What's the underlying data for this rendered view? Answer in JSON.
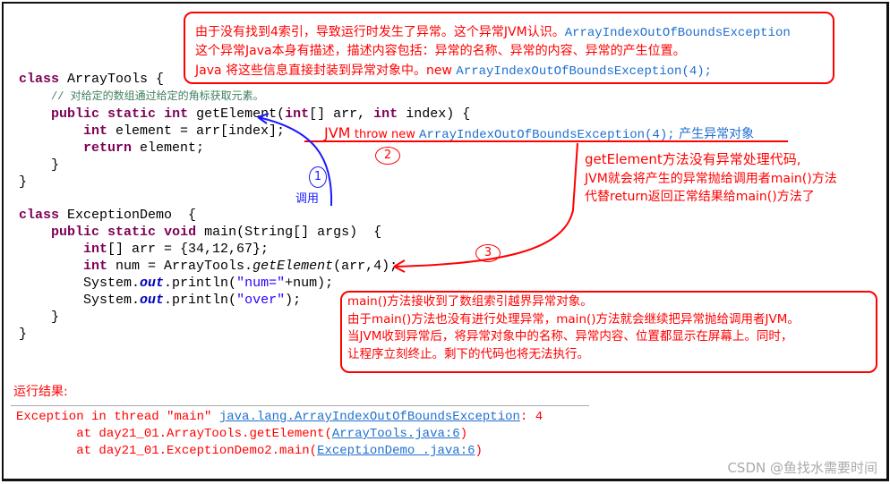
{
  "colors": {
    "annotation": "#ff0000",
    "accent_blue": "#1e6fd0",
    "keyword": "#7f0055",
    "comment": "#3f7f5f"
  },
  "top_box": {
    "line1_cn": "由于没有找到4索引，导致运行时发生了异常。这个异常JVM认识。",
    "line1_code": "ArrayIndexOutOfBoundsException",
    "line2": "这个异常Java本身有描述，描述内容包括：异常的名称、异常的内容、异常的产生位置。",
    "line3_cn": "Java 将这些信息直接封装到异常对象中。new ",
    "line3_code": "ArrayIndexOutOfBoundsException(4);"
  },
  "code": {
    "class1": "ArrayTools {",
    "comment": "// 对给定的数组通过给定的角标获取元素。",
    "method1": "getElement(",
    "method1_params": "[] arr, ",
    "method1_params2": " index) {",
    "line_element": " element = arr[index];",
    "line_return": " element;",
    "class2": "ExceptionDemo  {",
    "main_sig": " main(String[] args)  {",
    "arr_decl": "[] arr = {34,12,67};",
    "num_decl1": " num = ArrayTools.",
    "num_decl_method": "getElement",
    "num_decl2": "(arr,4);",
    "println1a": "System.",
    "println_out": "out",
    "println1b": ".println(",
    "println1_str": "\"num=\"",
    "println1c": "+num);",
    "println2_str": "\"over\"",
    "println2c": ");"
  },
  "throw_note": {
    "jvm": "JVM",
    "throw": "throw new ",
    "code": "ArrayIndexOutOfBoundsException(4);",
    "cn": " 产生异常对象"
  },
  "steps": {
    "one": "1",
    "two": "2",
    "three": "3",
    "call_label": "调用"
  },
  "side_note": {
    "line1": "getElement方法没有异常处理代码,",
    "line2": "JVM就会将产生的异常抛给调用者main()方法",
    "line3": "代替return返回正常结果给main()方法了"
  },
  "bottom_box": {
    "line1": "main()方法接收到了数组索引越界异常对象。",
    "line2": "由于main()方法也没有进行处理异常，main()方法就会继续把异常抛给调用者JVM。",
    "line3": "当JVM收到异常后，将异常对象中的名称、异常内容、位置都显示在屏幕上。同时，",
    "line4": "让程序立刻终止。剩下的代码也将无法执行。"
  },
  "result": {
    "label": "运行结果:",
    "line1_pre": "Exception in thread \"main\" ",
    "line1_link": "java.lang.ArrayIndexOutOfBoundsException",
    "line1_post": ": 4",
    "line2_pre": "        at day21_01.ArrayTools.getElement(",
    "line2_link": "ArrayTools.java:6",
    "line3_pre": "        at day21_01.ExceptionDemo2.main(",
    "line3_link": "ExceptionDemo .java:6",
    "close": ")"
  },
  "kw": {
    "class": "class",
    "public": "public",
    "static": "static",
    "int": "int",
    "return": "return",
    "void": "void"
  },
  "watermark": "CSDN @鱼找水需要时间"
}
